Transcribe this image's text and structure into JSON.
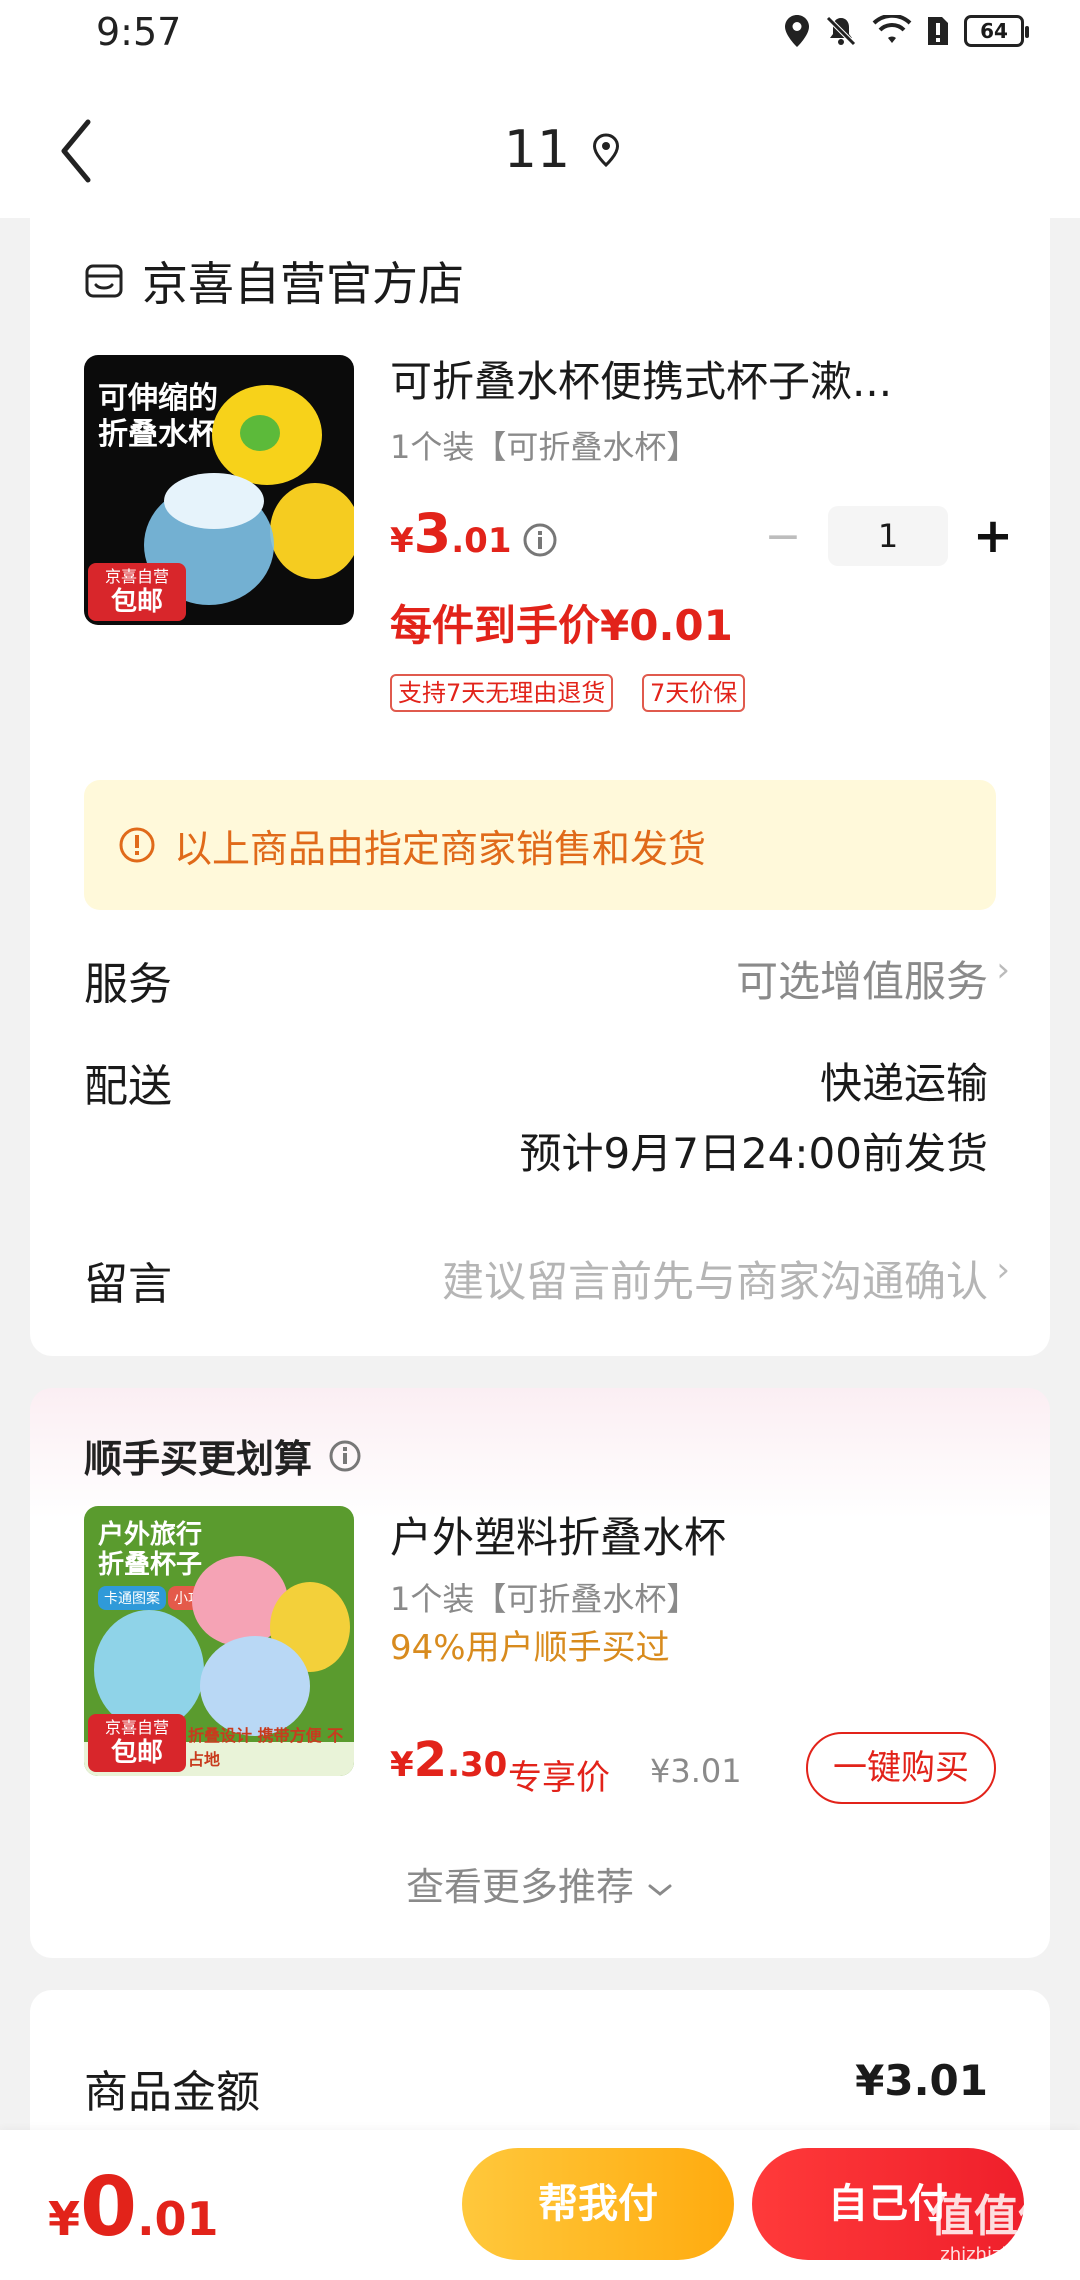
{
  "status_bar": {
    "time": "9:57",
    "battery": "64"
  },
  "nav": {
    "title": "11"
  },
  "shop": {
    "name": "京喜自营官方店"
  },
  "product": {
    "title": "可折叠水杯便携式杯子漱...",
    "spec": "1个装【可折叠水杯】",
    "price_yen": "¥",
    "price_int": "3",
    "price_dec": ".01",
    "quantity": "1",
    "arrival_price": "每件到手价¥0.01",
    "badges": [
      "支持7天无理由退货",
      "7天价保"
    ],
    "image": {
      "title_line1": "可伸缩的",
      "title_line2": "折叠水杯",
      "tag_top": "京喜自营",
      "tag_main": "包邮"
    }
  },
  "notice": {
    "text": "以上商品由指定商家销售和发货"
  },
  "rows": {
    "service_label": "服务",
    "service_value": "可选增值服务",
    "delivery_label": "配送",
    "delivery_value": "快递运输",
    "delivery_estimate": "预计9月7日24:00前发货",
    "message_label": "留言",
    "message_placeholder": "建议留言前先与商家沟通确认"
  },
  "recommend": {
    "title": "顺手买更划算",
    "product_title": "户外塑料折叠水杯",
    "spec": "1个装【可折叠水杯】",
    "social_proof": "94%用户顺手买过",
    "price_yen": "¥",
    "price_int": "2",
    "price_dec": ".30",
    "exclusive_label": "专享价",
    "old_price": "¥3.01",
    "buy_button": "一键购买",
    "more": "查看更多推荐",
    "image": {
      "title_line1": "户外旅行",
      "title_line2": "折叠杯子",
      "chip1": "卡通图案",
      "chip2": "小巧便携",
      "tag_top": "京喜自营",
      "tag_main": "包邮",
      "strip": "折叠设计 携带方便 不占地"
    }
  },
  "summary": {
    "goods_amount_label": "商品金额",
    "goods_amount_value": "¥3.01"
  },
  "bottom": {
    "total_yen": "¥",
    "total_int": "0",
    "total_dec": ".01",
    "help_pay": "帮我付",
    "self_pay": "自己付"
  },
  "watermark": {
    "text": "值值值",
    "url": "zhizhizhi.com"
  },
  "colors": {
    "accent_red": "#e2231a",
    "notice_bg": "#fff9da",
    "notice_text": "#e06a1a",
    "help_pay_yellow": "#ffb61f"
  }
}
